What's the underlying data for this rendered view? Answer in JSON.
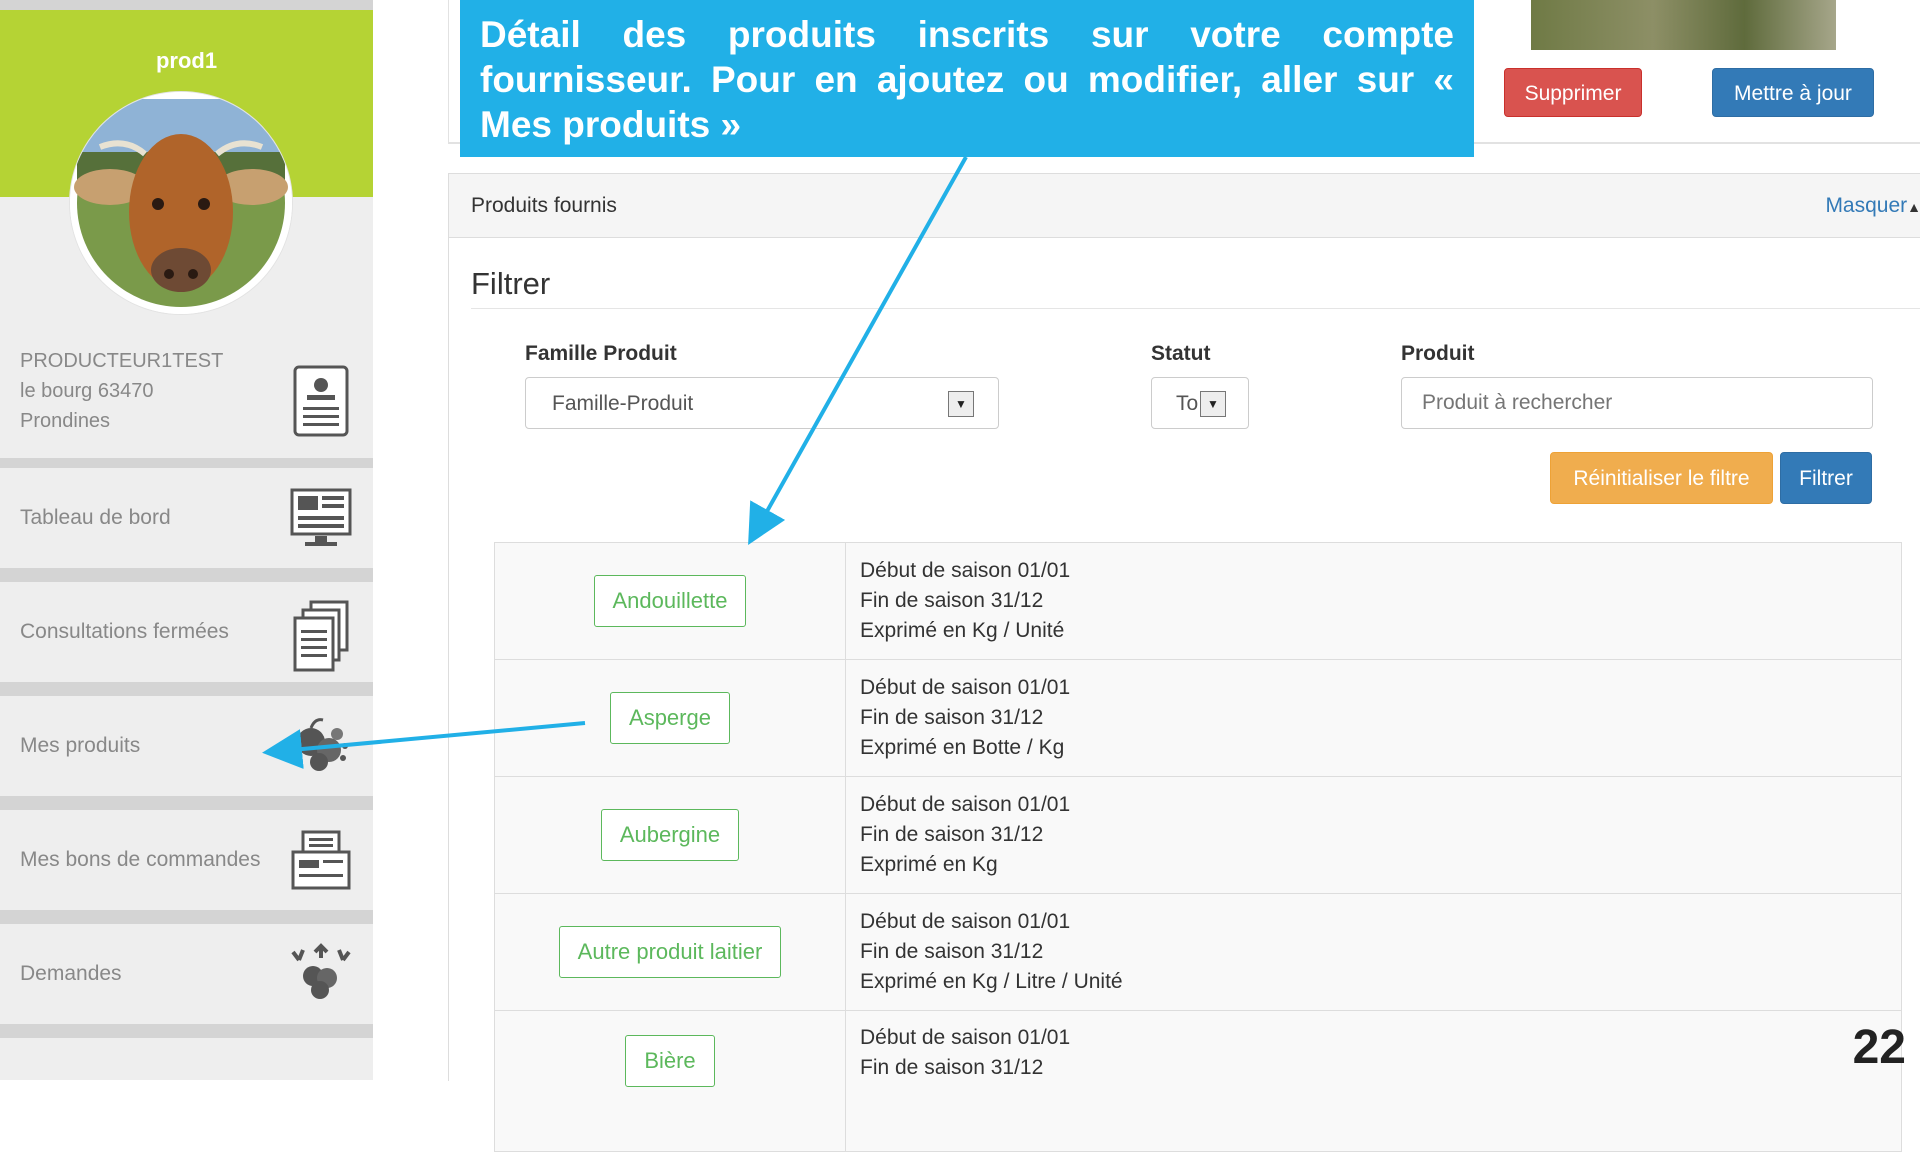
{
  "sidebar": {
    "profile": {
      "name": "prod1",
      "producer_name": "PRODUCTEUR1TEST",
      "address_line1": "le bourg 63470",
      "address_line2": "Prondines",
      "icon": "contact-card-icon"
    },
    "items": [
      {
        "label": "Tableau de bord",
        "icon": "dashboard-icon"
      },
      {
        "label": "Consultations fermées",
        "icon": "documents-icon"
      },
      {
        "label": "Mes produits",
        "icon": "produce-icon"
      },
      {
        "label": "Mes bons de commandes",
        "icon": "order-tray-icon"
      },
      {
        "label": "Demandes",
        "icon": "requests-produce-icon"
      }
    ]
  },
  "top": {
    "delete_label": "Supprimer",
    "update_label": "Mettre à jour"
  },
  "panel": {
    "title": "Produits fournis",
    "toggle_label": "Masquer"
  },
  "filter": {
    "title": "Filtrer",
    "famille_label": "Famille Produit",
    "famille_value": "Famille-Produit",
    "statut_label": "Statut",
    "statut_value": "To",
    "produit_label": "Produit",
    "produit_placeholder": "Produit à rechercher",
    "reset_label": "Réinitialiser le filtre",
    "filter_label": "Filtrer"
  },
  "products": [
    {
      "name": "Andouillette",
      "debut": "Début de saison 01/01",
      "fin": "Fin de saison 31/12",
      "unit": "Exprimé en Kg / Unité"
    },
    {
      "name": "Asperge",
      "debut": "Début de saison 01/01",
      "fin": "Fin de saison 31/12",
      "unit": "Exprimé en Botte / Kg"
    },
    {
      "name": "Aubergine",
      "debut": "Début de saison 01/01",
      "fin": "Fin de saison 31/12",
      "unit": "Exprimé en Kg"
    },
    {
      "name": "Autre produit laitier",
      "debut": "Début de saison 01/01",
      "fin": "Fin de saison 31/12",
      "unit": "Exprimé en Kg / Litre / Unité"
    },
    {
      "name": "Bière",
      "debut": "Début de saison 01/01",
      "fin": "Fin de saison 31/12",
      "unit": ""
    }
  ],
  "callout": {
    "text": "Détail des produits inscrits sur votre compte fournisseur. Pour en ajoutez ou modifier, aller sur « Mes produits »"
  },
  "page_number": "22",
  "colors": {
    "brand_green": "#b5d334",
    "callout_blue": "#21b0e7",
    "danger": "#d9534f",
    "primary": "#337ab7",
    "warning": "#f0ad4e",
    "success": "#5cb85c"
  }
}
